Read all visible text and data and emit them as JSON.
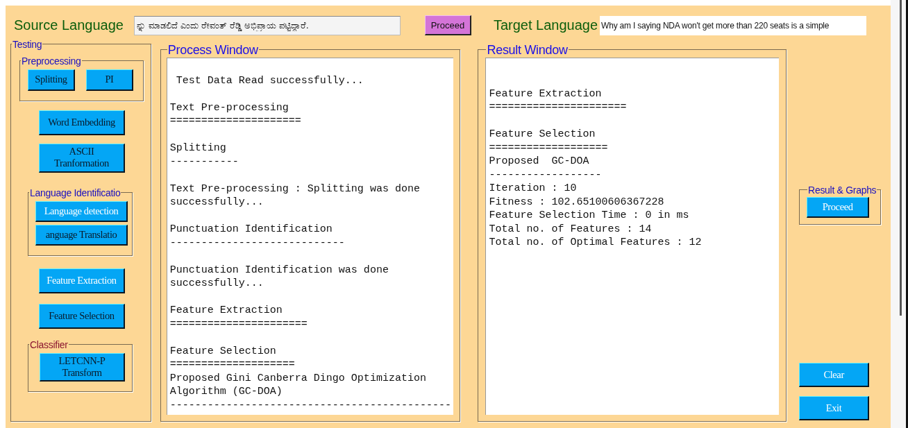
{
  "source": {
    "label": "Source Language",
    "value": "ನ್ನು ಮಾಡಲಿದೆ ಎಂದು ರೇವಂತ್ ರೆಡ್ಡಿ ಅಭಿಪ್ರಾಯ ಪಟ್ಟಿದ್ದಾರೆ.",
    "button": "Proceed"
  },
  "target": {
    "label": "Target Language",
    "value": "Why am I saying NDA won't get more than 220 seats is a simple"
  },
  "testing": {
    "title": "Testing",
    "items": [
      {
        "kind": "button-row",
        "title": "Preprocessing",
        "color": "#1a10c0",
        "buttons": [
          {
            "label": "Splitting",
            "highlighted": false
          },
          {
            "label": "PI",
            "highlighted": false
          }
        ]
      },
      {
        "kind": "button",
        "label": "Word Embedding",
        "highlighted": false
      },
      {
        "kind": "button",
        "label": "ASCII\nTranformation",
        "highlighted": false
      },
      {
        "kind": "group",
        "title": "Language Identificatio",
        "color": "#1a10c0",
        "buttons": [
          {
            "label": "Language detection",
            "highlighted": true
          },
          {
            "label": "anguage Translatio",
            "highlighted": false
          }
        ]
      },
      {
        "kind": "button",
        "label": "Feature Extraction",
        "highlighted": true
      },
      {
        "kind": "button",
        "label": "Feature Selection",
        "highlighted": false
      },
      {
        "kind": "group",
        "title": "Classifier",
        "color": "#8a1530",
        "buttons": [
          {
            "label": "LETCNN-P\nTransform",
            "highlighted": false
          }
        ]
      }
    ]
  },
  "process_window": {
    "title": "Process Window",
    "blocks": [
      [
        " Test Data Read successfully..."
      ],
      [
        "Text Pre-processing",
        "====================="
      ],
      [
        "Splitting",
        "-----------"
      ],
      [
        "Text Pre-processing : Splitting was done",
        "successfully..."
      ],
      [
        "Punctuation Identification",
        "----------------------------"
      ],
      [
        "Punctuation Identification was done",
        "successfully..."
      ],
      [
        "Feature Extraction",
        "======================"
      ],
      [
        "Feature Selection",
        "====================",
        "Proposed Gini Canberra Dingo Optimization",
        "Algorithm (GC-DOA)",
        "---------------------------------------------"
      ]
    ]
  },
  "result_window": {
    "title": "Result Window",
    "blocks": [
      [
        "Feature Extraction",
        "======================"
      ],
      [
        "Feature Selection",
        "===================",
        "Proposed  GC-DOA",
        "------------------",
        "Iteration : 10",
        "Fitness : 102.65100606367228",
        "Feature Selection Time : 0 in ms",
        "Total no. of Features : 14",
        "Total no. of Optimal Features : 12"
      ]
    ]
  },
  "result_graphs": {
    "title": "Result & Graphs",
    "button": {
      "label": "Proceed",
      "highlighted": true
    }
  },
  "actions": [
    {
      "label": "Clear",
      "highlighted": true
    },
    {
      "label": "Exit",
      "highlighted": true
    }
  ]
}
